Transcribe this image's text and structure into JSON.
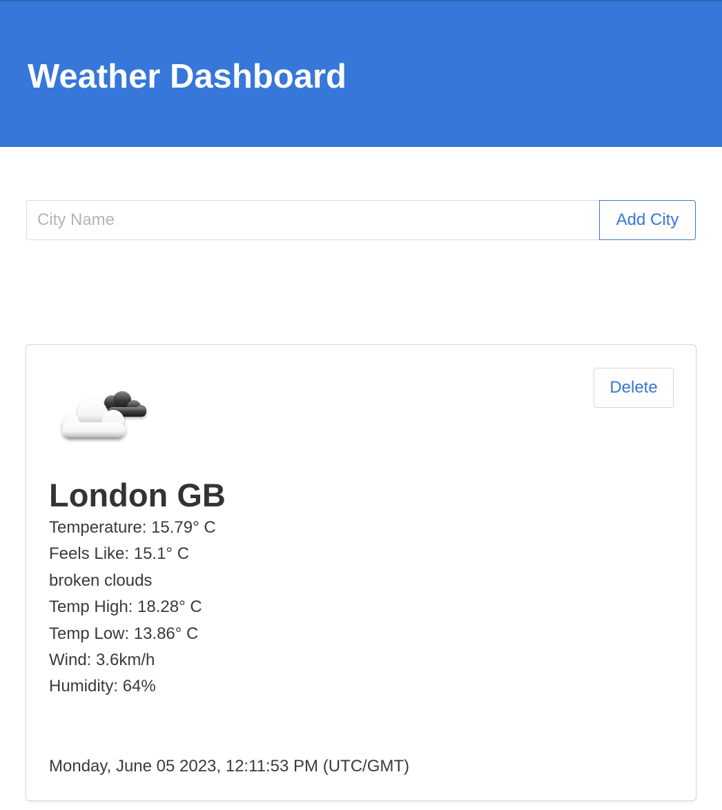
{
  "header": {
    "title": "Weather Dashboard",
    "background_color": "#3677d9"
  },
  "search": {
    "placeholder": "City Name",
    "value": "",
    "add_label": "Add City"
  },
  "card": {
    "delete_label": "Delete",
    "icon": "broken-clouds-icon",
    "city": "London GB",
    "temperature": "Temperature: 15.79° C",
    "feels_like": "Feels Like: 15.1° C",
    "description": "broken clouds",
    "temp_high": "Temp High: 18.28° C",
    "temp_low": "Temp Low: 13.86° C",
    "wind": "Wind: 3.6km/h",
    "humidity": "Humidity: 64%",
    "timestamp": "Monday, June 05 2023, 12:11:53 PM (UTC/GMT)"
  },
  "accent_color": "#3677d9"
}
